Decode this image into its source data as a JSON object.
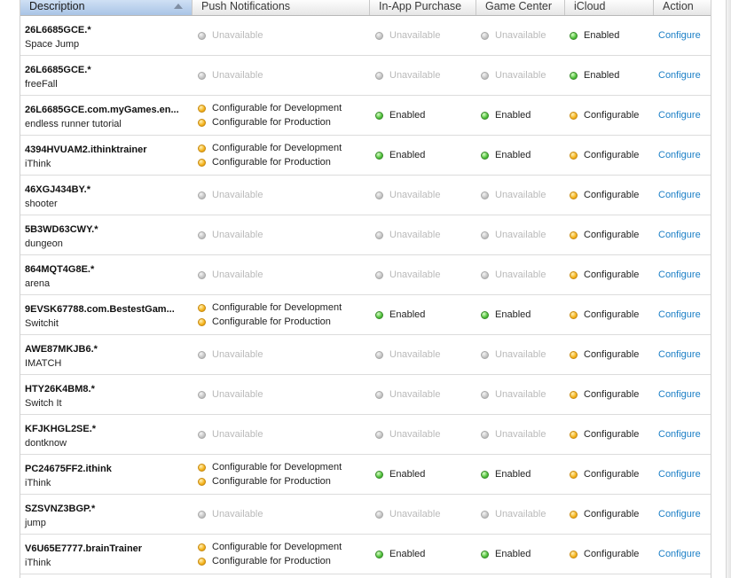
{
  "columns": {
    "description": "Description",
    "push": "Push Notifications",
    "iap": "In-App Purchase",
    "gc": "Game Center",
    "icloud": "iCloud",
    "action": "Action"
  },
  "labels": {
    "unavailable": "Unavailable",
    "enabled": "Enabled",
    "configurable": "Configurable",
    "config_dev": "Configurable for Development",
    "config_prod": "Configurable for Production",
    "configure": "Configure"
  },
  "colors": {
    "link": "#1b7fc6",
    "enabled_dot": "#4fc13a",
    "configurable_dot": "#f5b31c",
    "unavailable_dot": "#bdbdbd"
  },
  "rows": [
    {
      "id": "26L6685GCE.*",
      "name": "Space Jump",
      "push": "unavailable",
      "iap": "unavailable",
      "gc": "unavailable",
      "icloud": "enabled"
    },
    {
      "id": "26L6685GCE.*",
      "name": "freeFall",
      "push": "unavailable",
      "iap": "unavailable",
      "gc": "unavailable",
      "icloud": "enabled"
    },
    {
      "id": "26L6685GCE.com.myGames.en...",
      "name": "endless runner tutorial",
      "push": "configurable",
      "iap": "enabled",
      "gc": "enabled",
      "icloud": "configurable"
    },
    {
      "id": "4394HVUAM2.ithinktrainer",
      "name": "iThink",
      "push": "configurable",
      "iap": "enabled",
      "gc": "enabled",
      "icloud": "configurable"
    },
    {
      "id": "46XGJ434BY.*",
      "name": "shooter",
      "push": "unavailable",
      "iap": "unavailable",
      "gc": "unavailable",
      "icloud": "configurable"
    },
    {
      "id": "5B3WD63CWY.*",
      "name": "dungeon",
      "push": "unavailable",
      "iap": "unavailable",
      "gc": "unavailable",
      "icloud": "configurable"
    },
    {
      "id": "864MQT4G8E.*",
      "name": "arena",
      "push": "unavailable",
      "iap": "unavailable",
      "gc": "unavailable",
      "icloud": "configurable"
    },
    {
      "id": "9EVSK67788.com.BestestGam...",
      "name": "Switchit",
      "push": "configurable",
      "iap": "enabled",
      "gc": "enabled",
      "icloud": "configurable"
    },
    {
      "id": "AWE87MKJB6.*",
      "name": "IMATCH",
      "push": "unavailable",
      "iap": "unavailable",
      "gc": "unavailable",
      "icloud": "configurable"
    },
    {
      "id": "HTY26K4BM8.*",
      "name": "Switch It",
      "push": "unavailable",
      "iap": "unavailable",
      "gc": "unavailable",
      "icloud": "configurable"
    },
    {
      "id": "KFJKHGL2SE.*",
      "name": "dontknow",
      "push": "unavailable",
      "iap": "unavailable",
      "gc": "unavailable",
      "icloud": "configurable"
    },
    {
      "id": "PC24675FF2.ithink",
      "name": "iThink",
      "push": "configurable",
      "iap": "enabled",
      "gc": "enabled",
      "icloud": "configurable"
    },
    {
      "id": "SZSVNZ3BGP.*",
      "name": "jump",
      "push": "unavailable",
      "iap": "unavailable",
      "gc": "unavailable",
      "icloud": "configurable"
    },
    {
      "id": "V6U65E7777.brainTrainer",
      "name": "iThink",
      "push": "configurable",
      "iap": "enabled",
      "gc": "enabled",
      "icloud": "configurable"
    }
  ]
}
